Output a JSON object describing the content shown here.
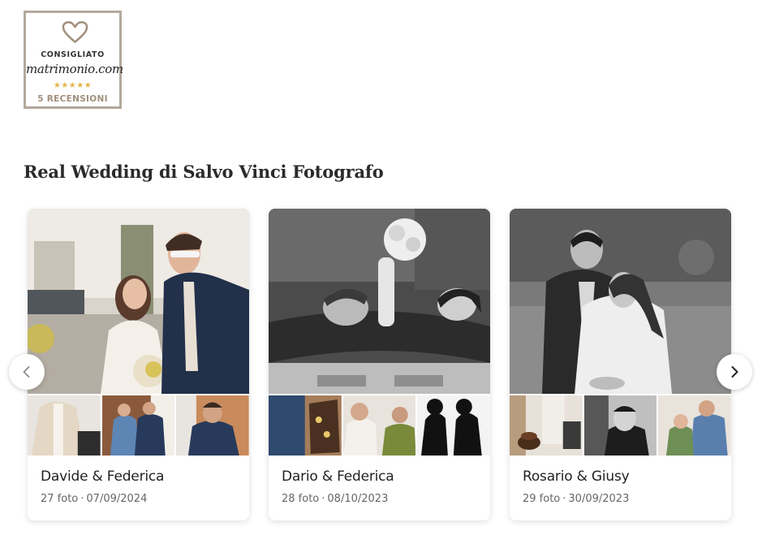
{
  "badge": {
    "line1": "CONSIGLIATO",
    "brand": "matrimonio.com",
    "stars": "★★★★★",
    "reviews": "5 RECENSIONI",
    "icon": "heart-icon",
    "border_color": "#b4a99b",
    "star_color": "#e2b64a"
  },
  "section": {
    "title": "Real Wedding di Salvo Vinci Fotografo"
  },
  "carousel": {
    "prev_icon": "chevron-left-icon",
    "next_icon": "chevron-right-icon",
    "cards": [
      {
        "title": "Davide & Federica",
        "photos": "27 foto",
        "sep": "·",
        "date": "07/09/2024"
      },
      {
        "title": "Dario & Federica",
        "photos": "28 foto",
        "sep": "·",
        "date": "08/10/2023"
      },
      {
        "title": "Rosario & Giusy",
        "photos": "29 foto",
        "sep": "·",
        "date": "30/09/2023"
      }
    ]
  }
}
